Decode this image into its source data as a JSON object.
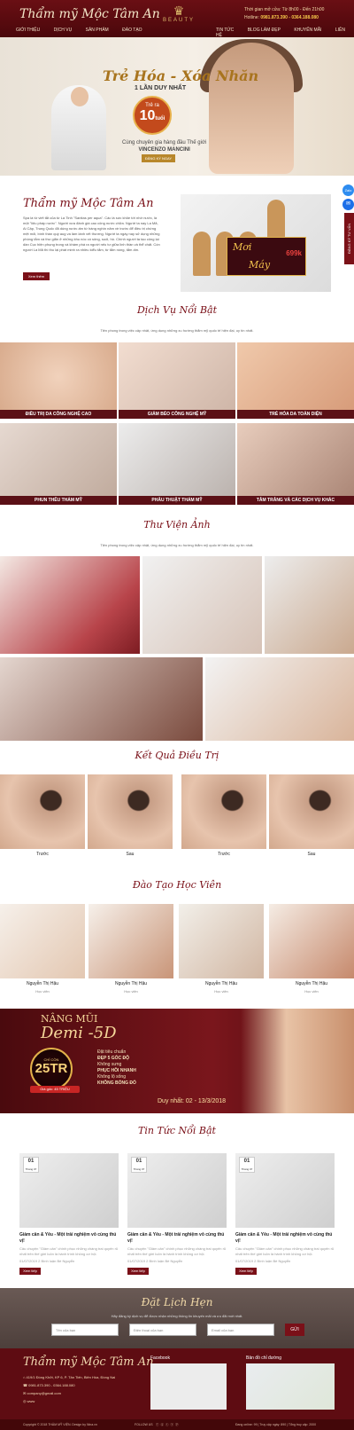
{
  "header": {
    "logo": "Thẩm mỹ Mộc Tâm An",
    "brand_text": "BEAUTY",
    "hours": "Thời gian mở cửa: Từ 8h00 - Đến 21h00",
    "hotline_label": "Hotline:",
    "hotline": "0981.873.390 - 0364.188.080",
    "nav_left": [
      "GIỚI THIỆU",
      "DỊCH VỤ",
      "SẢN PHẨM",
      "ĐÀO TẠO"
    ],
    "nav_right": [
      "TIN TỨC",
      "BLOG LÀM ĐẸP",
      "KHUYẾN MÃI",
      "LIÊN HỆ"
    ]
  },
  "hero": {
    "title": "Trẻ Hóa - Xóa Nhăn",
    "subtitle": "1 LẦN DUY NHẤT",
    "badge_top": "Trẻ ra",
    "badge_value": "10",
    "badge_unit": "tuổi",
    "text1": "Cùng chuyên gia hàng đầu Thế giới",
    "text2": "VINCENZO MANCINI",
    "cta": "ĐĂNG KÝ NGAY"
  },
  "side": {
    "zalo": "Zalo",
    "tab": "ĐĂNG KÝ TƯ VẤN"
  },
  "about": {
    "title": "Thẩm mỹ Mộc Tâm An",
    "paragraph": "Spa là từ viết tắt của từ La Tinh \"Sanitas per aqua\". Các là sức khỏe tới nhờ nước, là một \"liệu pháp nước\". Người xưa đánh giá cao công nước chữa. Người ta nay La Mã, Ai Cập, Trung Quốc đã dùng nước ấm từ hàng nghìn năm về trước để điều trị chứng mệt mỏi, bình thần quý aug va làm lành vết thương. Người ta ngày nay sử dụng những phòng tắm và thư giãn ở những khu nóc có sông, suối, hồ. Chính người ta tạo công lại dần Cục hiện phụng trong và khám phá ra người nếu tư giữa linh thần và thể chất. Còn người La Mã thì thu lại phát minh ra nhiều kiểu tắm, từ tắm nóng, tắm ấm.",
    "button": "Xem thêm",
    "promo_word1": "Mơi",
    "promo_word2": "Máy",
    "promo_price": "699k"
  },
  "services": {
    "title": "Dịch Vụ Nổi Bật",
    "subtitle": "Tiên phong trong việc cập nhật, ứng dụng những xu hướng thẩm mỹ quốc tế hiện đại, uy tín nhất.",
    "items": [
      "ĐIỀU TRỊ DA CÔNG NGHỆ CAO",
      "GIẢM BÉO CÔNG NGHỆ MỸ",
      "TRẺ HÓA DA TOÀN DIỆN",
      "PHUN THÊU THẨM MỸ",
      "PHẪU THUẬT THẨM MỸ",
      "TẮM TRẮNG VÀ CÁC DỊCH VỤ KHÁC"
    ]
  },
  "gallery": {
    "title": "Thư Viện Ảnh",
    "subtitle": "Tiên phong trong việc cập nhật, ứng dụng những xu hướng thẩm mỹ quốc tế hiện đại, uy tín nhất."
  },
  "results": {
    "title": "Kết Quả Điều Trị",
    "labels": [
      "Trước",
      "Sau",
      "Trước",
      "Sau"
    ]
  },
  "training": {
    "title": "Đào Tạo Học Viên",
    "students": [
      {
        "name": "Nguyễn Thị Hậu",
        "role": "Học viên"
      },
      {
        "name": "Nguyễn Thị Hậu",
        "role": "Học viên"
      },
      {
        "name": "Nguyễn Thị Hậu",
        "role": "Học viên"
      },
      {
        "name": "Nguyễn Thị Hậu",
        "role": "Học viên"
      }
    ]
  },
  "banner": {
    "line1": "NÂNG MŨI",
    "line2": "Demi -5D",
    "coin_small": "CHỈ CÒN",
    "coin_value": "25TR",
    "tag": "Giá gốc: 45 TRIỆU",
    "features": [
      "Đặt tiêu chuẩn",
      "ĐẸP 5 GÓC ĐỘ",
      "Không sưng",
      "PHỤC HỒI NHANH",
      "Không lộ sống",
      "KHÔNG BÓNG ĐỎ"
    ],
    "date": "Duy nhất: 02 - 13/3/2018"
  },
  "news": {
    "title": "Tin Tức Nổi Bật",
    "items": [
      {
        "day": "01",
        "month": "Tháng 07",
        "title": "Giảm cân & Yêu - Một trải nghiệm vô cùng thú vị!",
        "excerpt": "Câu chuyện \"Giảm cân\" chính phục những chàng trai quyến rũ nhất trên thế giới luôn là hành trình không cơ hội.",
        "meta": "01/07/2019   2 Bình luận   Bé Nguyễn",
        "button": "Xem tiếp"
      },
      {
        "day": "01",
        "month": "Tháng 07",
        "title": "Giảm cân & Yêu - Một trải nghiệm vô cùng thú vị!",
        "excerpt": "Câu chuyện \"Giảm cân\" chính phục những chàng trai quyến rũ nhất trên thế giới luôn là hành trình không cơ hội.",
        "meta": "01/07/2019   2 Bình luận   Bé Nguyễn",
        "button": "Xem tiếp"
      },
      {
        "day": "01",
        "month": "Tháng 07",
        "title": "Giảm cân & Yêu - Một trải nghiệm vô cùng thú vị!",
        "excerpt": "Câu chuyện \"Giảm cân\" chính phục những chàng trai quyến rũ nhất trên thế giới luôn là hành trình không cơ hội.",
        "meta": "01/07/2019   2 Bình luận   Bé Nguyễn",
        "button": "Xem tiếp"
      }
    ]
  },
  "booking": {
    "title": "Đặt Lịch Hẹn",
    "subtitle": "Hãy đăng ký dịch vụ để được nhận những thông tin khuyến mãi và ưu đãi mới nhất.",
    "placeholders": [
      "Tên của bạn",
      "Điện thoại của bạn",
      "Email của bạn"
    ],
    "button": "GỬI"
  },
  "footer": {
    "logo": "Thẩm mỹ Mộc Tâm An",
    "address": "419/1 Đồng Khởi, KP 6, P. Tân Tiến, Biên Hòa, Đồng Nai",
    "phone": "0981.873.390 - 0364.188.080",
    "email": "company@gmail.com",
    "web": "www",
    "facebook_label": "Facebook",
    "map_label": "Bản đồ chỉ đường",
    "copyright": "Copyright © 2018 THẨM MỸ VIỆN. Design by Nina.vn",
    "follow": "FOLLOW US",
    "stats": "Đang online: 99  |  Truy cập ngày: 890  |  Tổng truy cập: 2000"
  }
}
